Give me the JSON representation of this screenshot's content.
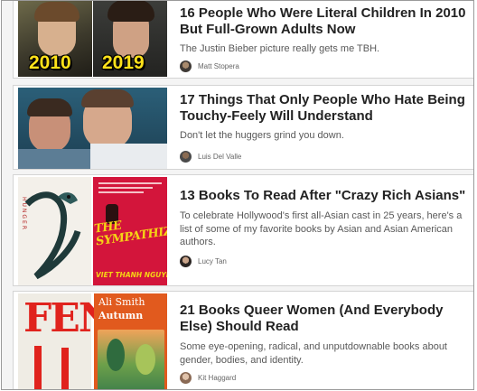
{
  "articles": [
    {
      "title": "16 People Who Were Literal Children In 2010 But Full-Grown Adults Now",
      "description": "The Justin Bieber picture really gets me TBH.",
      "author": "Matt Stopera",
      "thumbnail_labels": [
        "2010",
        "2019"
      ]
    },
    {
      "title": "17 Things That Only People Who Hate Being Touchy-Feely Will Understand",
      "description": "Don't let the huggers grind you down.",
      "author": "Luis Del Valle"
    },
    {
      "title": "13 Books To Read After \"Crazy Rich Asians\"",
      "description": "To celebrate Hollywood's first all-Asian cast in 25 years, here's a list of some of my favorite books by Asian and Asian American authors.",
      "author": "Lucy Tan",
      "thumbnail_labels": [
        "THE SYMPATHIZER",
        "VIET THANH NGUYEN",
        "HUNGER"
      ]
    },
    {
      "title": "21 Books Queer Women (And Everybody Else) Should Read",
      "description": "Some eye-opening, radical, and unputdownable books about gender, bodies, and identity.",
      "author": "Kit Haggard",
      "thumbnail_labels": [
        "FEN",
        "Ali Smith",
        "Autumn"
      ]
    }
  ]
}
